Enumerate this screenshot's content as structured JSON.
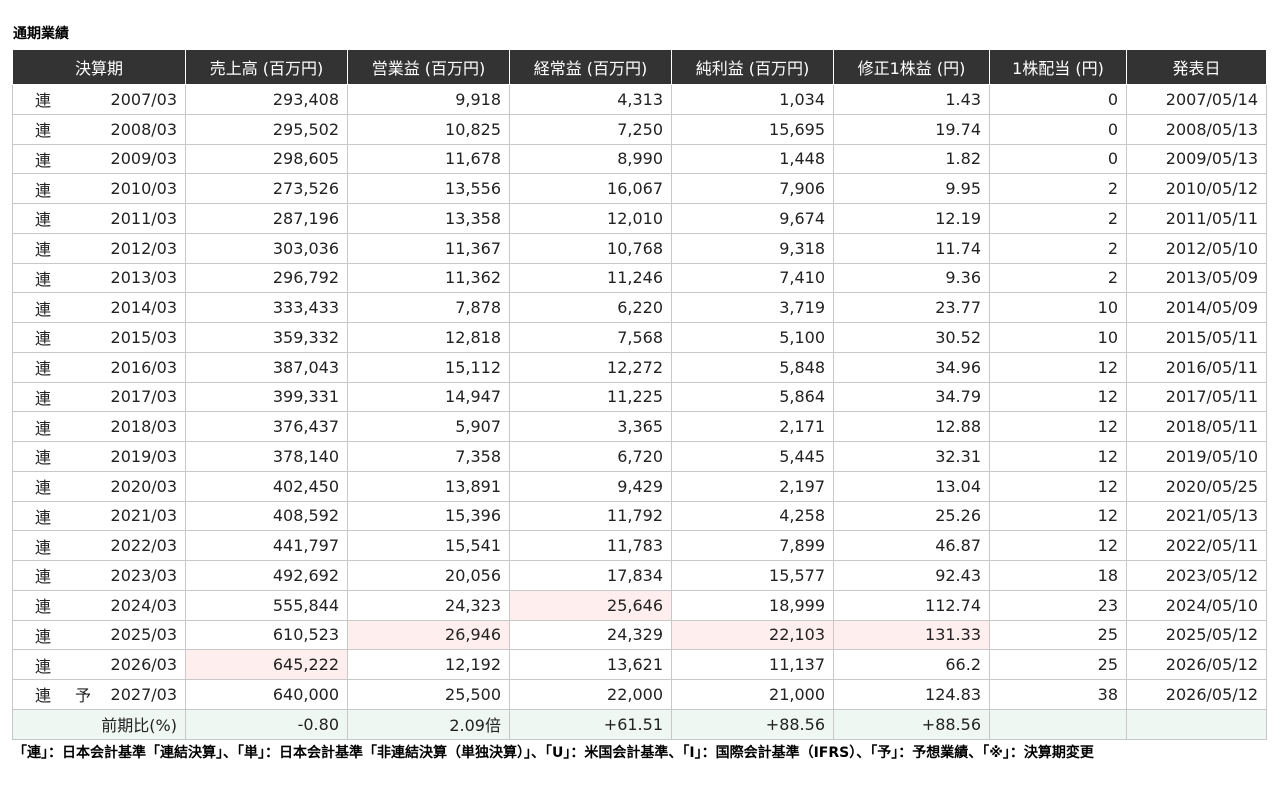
{
  "page": {
    "title": "通期業績",
    "footnote": "「連」：日本会計基準「連結決算」、「単」：日本会計基準「非連結決算（単独決算）」、「U」：米国会計基準、「I」：国際会計基準（IFRS）、「予」：予想業績、「※」：決算期変更"
  },
  "table": {
    "headers": [
      "決算期",
      "売上高 (百万円)",
      "営業益 (百万円)",
      "経常益 (百万円)",
      "純利益 (百万円)",
      "修正1株益 (円)",
      "1株配当 (円)",
      "発表日"
    ],
    "rows": [
      {
        "basis": "連",
        "forecast": "",
        "period": "2007/03",
        "sales": "293,408",
        "operating": "9,918",
        "ordinary": "4,313",
        "net": "1,034",
        "eps": "1.43",
        "dividend": "0",
        "date": "2007/05/14",
        "hl": []
      },
      {
        "basis": "連",
        "forecast": "",
        "period": "2008/03",
        "sales": "295,502",
        "operating": "10,825",
        "ordinary": "7,250",
        "net": "15,695",
        "eps": "19.74",
        "dividend": "0",
        "date": "2008/05/13",
        "hl": []
      },
      {
        "basis": "連",
        "forecast": "",
        "period": "2009/03",
        "sales": "298,605",
        "operating": "11,678",
        "ordinary": "8,990",
        "net": "1,448",
        "eps": "1.82",
        "dividend": "0",
        "date": "2009/05/13",
        "hl": []
      },
      {
        "basis": "連",
        "forecast": "",
        "period": "2010/03",
        "sales": "273,526",
        "operating": "13,556",
        "ordinary": "16,067",
        "net": "7,906",
        "eps": "9.95",
        "dividend": "2",
        "date": "2010/05/12",
        "hl": []
      },
      {
        "basis": "連",
        "forecast": "",
        "period": "2011/03",
        "sales": "287,196",
        "operating": "13,358",
        "ordinary": "12,010",
        "net": "9,674",
        "eps": "12.19",
        "dividend": "2",
        "date": "2011/05/11",
        "hl": []
      },
      {
        "basis": "連",
        "forecast": "",
        "period": "2012/03",
        "sales": "303,036",
        "operating": "11,367",
        "ordinary": "10,768",
        "net": "9,318",
        "eps": "11.74",
        "dividend": "2",
        "date": "2012/05/10",
        "hl": []
      },
      {
        "basis": "連",
        "forecast": "",
        "period": "2013/03",
        "sales": "296,792",
        "operating": "11,362",
        "ordinary": "11,246",
        "net": "7,410",
        "eps": "9.36",
        "dividend": "2",
        "date": "2013/05/09",
        "hl": []
      },
      {
        "basis": "連",
        "forecast": "",
        "period": "2014/03",
        "sales": "333,433",
        "operating": "7,878",
        "ordinary": "6,220",
        "net": "3,719",
        "eps": "23.77",
        "dividend": "10",
        "date": "2014/05/09",
        "hl": []
      },
      {
        "basis": "連",
        "forecast": "",
        "period": "2015/03",
        "sales": "359,332",
        "operating": "12,818",
        "ordinary": "7,568",
        "net": "5,100",
        "eps": "30.52",
        "dividend": "10",
        "date": "2015/05/11",
        "hl": []
      },
      {
        "basis": "連",
        "forecast": "",
        "period": "2016/03",
        "sales": "387,043",
        "operating": "15,112",
        "ordinary": "12,272",
        "net": "5,848",
        "eps": "34.96",
        "dividend": "12",
        "date": "2016/05/11",
        "hl": []
      },
      {
        "basis": "連",
        "forecast": "",
        "period": "2017/03",
        "sales": "399,331",
        "operating": "14,947",
        "ordinary": "11,225",
        "net": "5,864",
        "eps": "34.79",
        "dividend": "12",
        "date": "2017/05/11",
        "hl": []
      },
      {
        "basis": "連",
        "forecast": "",
        "period": "2018/03",
        "sales": "376,437",
        "operating": "5,907",
        "ordinary": "3,365",
        "net": "2,171",
        "eps": "12.88",
        "dividend": "12",
        "date": "2018/05/11",
        "hl": []
      },
      {
        "basis": "連",
        "forecast": "",
        "period": "2019/03",
        "sales": "378,140",
        "operating": "7,358",
        "ordinary": "6,720",
        "net": "5,445",
        "eps": "32.31",
        "dividend": "12",
        "date": "2019/05/10",
        "hl": []
      },
      {
        "basis": "連",
        "forecast": "",
        "period": "2020/03",
        "sales": "402,450",
        "operating": "13,891",
        "ordinary": "9,429",
        "net": "2,197",
        "eps": "13.04",
        "dividend": "12",
        "date": "2020/05/25",
        "hl": []
      },
      {
        "basis": "連",
        "forecast": "",
        "period": "2021/03",
        "sales": "408,592",
        "operating": "15,396",
        "ordinary": "11,792",
        "net": "4,258",
        "eps": "25.26",
        "dividend": "12",
        "date": "2021/05/13",
        "hl": []
      },
      {
        "basis": "連",
        "forecast": "",
        "period": "2022/03",
        "sales": "441,797",
        "operating": "15,541",
        "ordinary": "11,783",
        "net": "7,899",
        "eps": "46.87",
        "dividend": "12",
        "date": "2022/05/11",
        "hl": []
      },
      {
        "basis": "連",
        "forecast": "",
        "period": "2023/03",
        "sales": "492,692",
        "operating": "20,056",
        "ordinary": "17,834",
        "net": "15,577",
        "eps": "92.43",
        "dividend": "18",
        "date": "2023/05/12",
        "hl": []
      },
      {
        "basis": "連",
        "forecast": "",
        "period": "2024/03",
        "sales": "555,844",
        "operating": "24,323",
        "ordinary": "25,646",
        "net": "18,999",
        "eps": "112.74",
        "dividend": "23",
        "date": "2024/05/10",
        "hl": [
          "ordinary"
        ]
      },
      {
        "basis": "連",
        "forecast": "",
        "period": "2025/03",
        "sales": "610,523",
        "operating": "26,946",
        "ordinary": "24,329",
        "net": "22,103",
        "eps": "131.33",
        "dividend": "25",
        "date": "2025/05/12",
        "hl": [
          "operating",
          "net",
          "eps"
        ]
      },
      {
        "basis": "連",
        "forecast": "",
        "period": "2026/03",
        "sales": "645,222",
        "operating": "12,192",
        "ordinary": "13,621",
        "net": "11,137",
        "eps": "66.2",
        "dividend": "25",
        "date": "2026/05/12",
        "hl": [
          "sales"
        ]
      },
      {
        "basis": "連",
        "forecast": "予",
        "period": "2027/03",
        "sales": "640,000",
        "operating": "25,500",
        "ordinary": "22,000",
        "net": "21,000",
        "eps": "124.83",
        "dividend": "38",
        "date": "2026/05/12",
        "hl": []
      }
    ],
    "yoy": {
      "label": "前期比(%)",
      "sales": "-0.80",
      "operating": "2.09倍",
      "ordinary": "+61.51",
      "net": "+88.56",
      "eps": "+88.56",
      "dividend": "",
      "date": ""
    },
    "colors": {
      "header_bg": "#333333",
      "highlight_bg": "#ffeeee",
      "yoy_bg": "#eef7f2",
      "positive": "#e00000",
      "negative": "#2a9d2a"
    }
  }
}
